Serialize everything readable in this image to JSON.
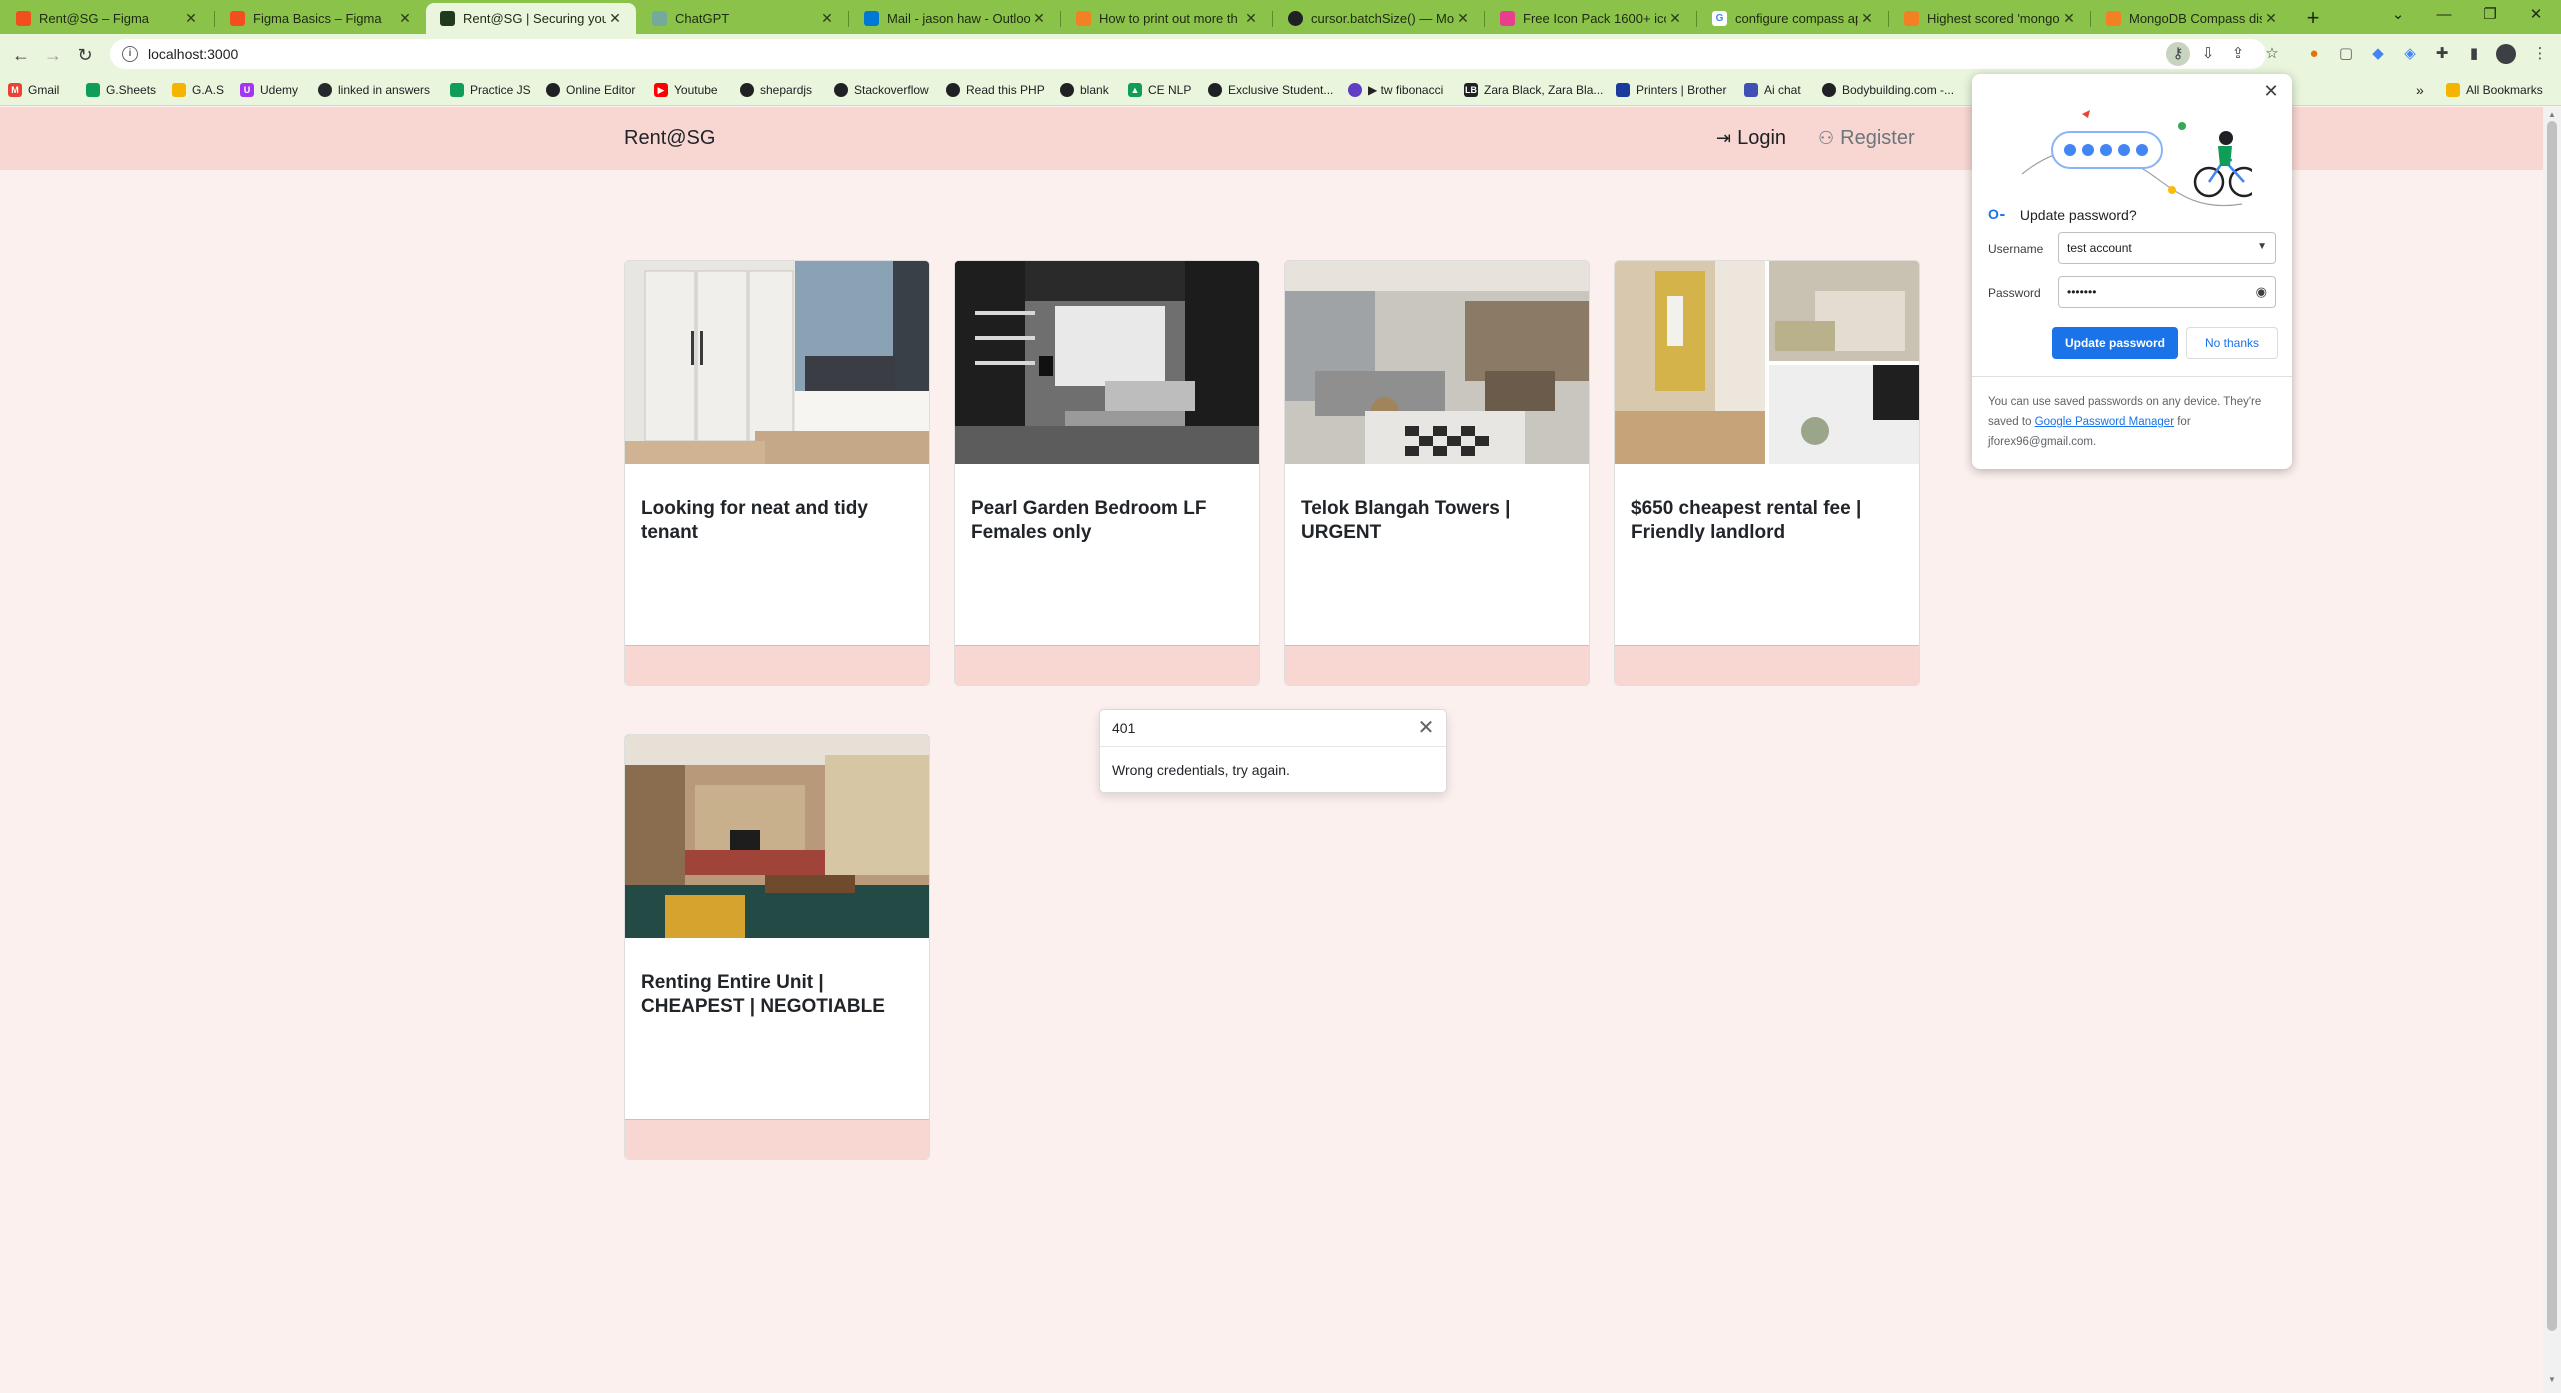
{
  "browser": {
    "tabs": [
      {
        "label": "Rent@SG – Figma",
        "fav_color": "#f24e1e",
        "fav_icon": "figma-icon"
      },
      {
        "label": "Figma Basics – Figma",
        "fav_color": "#f24e1e",
        "fav_icon": "figma-icon"
      },
      {
        "label": "Rent@SG | Securing your",
        "fav_color": "#1f3b1c",
        "fav_icon": "app-icon",
        "active": true
      },
      {
        "label": "ChatGPT",
        "fav_color": "#74aa9c",
        "fav_icon": "chatgpt-icon"
      },
      {
        "label": "Mail - jason haw - Outlook",
        "fav_color": "#0078d4",
        "fav_icon": "outlook-icon"
      },
      {
        "label": "How to print out more th",
        "fav_color": "#f48024",
        "fav_icon": "stackoverflow-icon"
      },
      {
        "label": "cursor.batchSize() — Mon",
        "fav_color": "#202124",
        "fav_icon": "mongodb-icon"
      },
      {
        "label": "Free Icon Pack 1600+ ico",
        "fav_color": "#e83e8c",
        "fav_icon": "iconpack-icon"
      },
      {
        "label": "configure compass app to",
        "fav_color": "#4285f4",
        "fav_icon": "google-icon"
      },
      {
        "label": "Highest scored 'mongodb",
        "fav_color": "#f48024",
        "fav_icon": "stackoverflow-icon"
      },
      {
        "label": "MongoDB Compass displ",
        "fav_color": "#f48024",
        "fav_icon": "stackoverflow-icon"
      }
    ],
    "url": "localhost:3000",
    "bookmarks": [
      {
        "label": "Gmail",
        "color": "#ea4335",
        "icon": "gmail-icon"
      },
      {
        "label": "G.Sheets",
        "color": "#0f9d58",
        "icon": "sheets-icon"
      },
      {
        "label": "G.A.S",
        "color": "#f4b400",
        "icon": "apps-script-icon"
      },
      {
        "label": "Udemy",
        "color": "#a435f0",
        "icon": "udemy-icon"
      },
      {
        "label": "linked in answers",
        "color": "#24292e",
        "icon": "github-icon"
      },
      {
        "label": "Practice JS",
        "color": "#0f9d58",
        "icon": "sheets-icon"
      },
      {
        "label": "Online Editor",
        "color": "#202124",
        "icon": "editor-icon"
      },
      {
        "label": "Youtube",
        "color": "#ff0000",
        "icon": "youtube-icon"
      },
      {
        "label": "shepardjs",
        "color": "#202124",
        "icon": "shepard-icon"
      },
      {
        "label": "Stackoverflow",
        "color": "#202124",
        "icon": "stackoverflow-icon"
      },
      {
        "label": "Read this PHP",
        "color": "#202124",
        "icon": "hat-icon"
      },
      {
        "label": "blank",
        "color": "#202124",
        "icon": "globe-icon"
      },
      {
        "label": "CE NLP",
        "color": "#0f9d58",
        "icon": "drive-icon"
      },
      {
        "label": "Exclusive Student...",
        "color": "#202124",
        "icon": "globe-icon"
      },
      {
        "label": "▶ tw fibonacci",
        "color": "#5f3dc4",
        "icon": "twitch-icon"
      },
      {
        "label": "Zara Black, Zara Bla...",
        "color": "#202124",
        "icon": "lb-icon"
      },
      {
        "label": "Printers | Brother",
        "color": "#1a3b9c",
        "icon": "brother-icon"
      },
      {
        "label": "Ai chat",
        "color": "#3f51b5",
        "icon": "ai-icon"
      },
      {
        "label": "Bodybuilding.com -...",
        "color": "#202124",
        "icon": "bodybuilding-icon"
      }
    ],
    "all_bookmarks_label": "All Bookmarks"
  },
  "navbar": {
    "brand": "Rent@SG",
    "login": "Login",
    "register": "Register"
  },
  "listings": [
    {
      "title": "Looking for neat and tidy tenant"
    },
    {
      "title": "Pearl Garden Bedroom LF Females only"
    },
    {
      "title": "Telok Blangah Towers | URGENT"
    },
    {
      "title": "$650 cheapest rental fee | Friendly landlord"
    },
    {
      "title": "Renting Entire Unit | CHEAPEST | NEGOTIABLE"
    }
  ],
  "toast": {
    "code": "401",
    "message": "Wrong credentials, try again."
  },
  "password_popup": {
    "title": "Update password?",
    "username_label": "Username",
    "username_value": "test account",
    "password_label": "Password",
    "password_value": "•••••••",
    "update_button": "Update password",
    "no_thanks_button": "No thanks",
    "footer_pre": "You can use saved passwords on any device. They're saved to ",
    "footer_link": "Google Password Manager",
    "footer_post": " for jforex96@gmail.com."
  },
  "colors": {
    "navbar_bg": "#f8d7d3",
    "page_bg": "#fcf0ee",
    "chrome_green": "#8bc34a",
    "accent_blue": "#1a73e8"
  }
}
